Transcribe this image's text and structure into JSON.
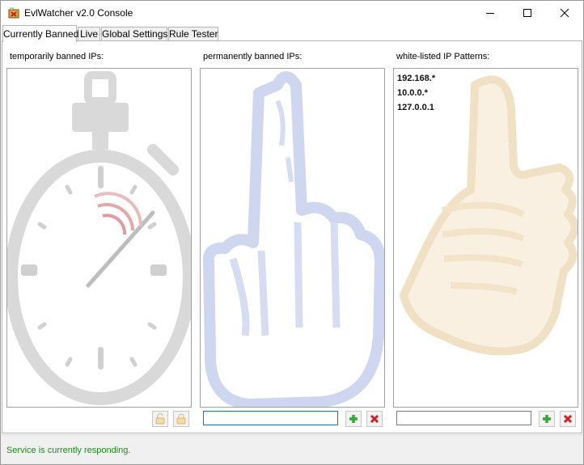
{
  "window": {
    "title": "EvlWatcher v2.0 Console"
  },
  "tabs": [
    {
      "label": "Currently Banned",
      "active": true
    },
    {
      "label": "Live",
      "active": false
    },
    {
      "label": "Global Settings",
      "active": false
    },
    {
      "label": "Rule Tester",
      "active": false
    }
  ],
  "panels": {
    "temporary": {
      "caption": "temporarily banned IPs:",
      "items": []
    },
    "permanent": {
      "caption": "permanently banned IPs:",
      "items": [],
      "input_value": ""
    },
    "whitelist": {
      "caption": "white-listed IP Patterns:",
      "items": [
        "192.168.*",
        "10.0.0.*",
        "127.0.0.1"
      ],
      "input_value": ""
    }
  },
  "status": {
    "text": "Service is currently responding.",
    "color": "#1a8a1a"
  },
  "icons": [
    "app-icon",
    "minimize-icon",
    "maximize-icon",
    "close-icon",
    "stopwatch-watermark",
    "finger-watermark",
    "thumbs-up-watermark",
    "unlock-icon",
    "lock-icon",
    "add-icon",
    "delete-icon"
  ],
  "colors": {
    "accent": "#0078d7",
    "add": "#3aa63a",
    "delete": "#d32020"
  }
}
